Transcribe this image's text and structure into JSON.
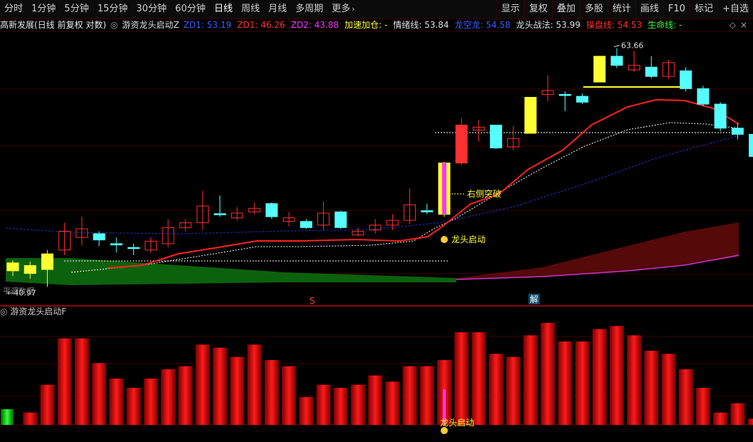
{
  "toolbar": {
    "periods": [
      {
        "label": "分时",
        "active": false
      },
      {
        "label": "1分钟",
        "active": false
      },
      {
        "label": "5分钟",
        "active": false
      },
      {
        "label": "15分钟",
        "active": false
      },
      {
        "label": "30分钟",
        "active": false
      },
      {
        "label": "60分钟",
        "active": false
      },
      {
        "label": "日线",
        "active": true
      },
      {
        "label": "周线",
        "active": false
      },
      {
        "label": "月线",
        "active": false
      },
      {
        "label": "多周期",
        "active": false
      },
      {
        "label": "更多",
        "active": false
      }
    ],
    "right_buttons": [
      "显示",
      "复权",
      "叠加",
      "多股",
      "统计",
      "画线",
      "F10",
      "标记",
      "+自选"
    ]
  },
  "infobar": {
    "stock": "高新发展(日线 前复权 对数)",
    "indicator": "游资龙头启动Z",
    "items": [
      {
        "label": "ZD1:",
        "value": "53.19",
        "color": "#3a5cff"
      },
      {
        "label": "ZD1:",
        "value": "46.26",
        "color": "#ff3030"
      },
      {
        "label": "ZD2:",
        "value": "43.88",
        "color": "#ff33ff"
      },
      {
        "label": "加速加仓:",
        "value": "-",
        "color": "#ffff33"
      },
      {
        "label": "情绪线:",
        "value": "53.84",
        "color": "#e0e0e0"
      },
      {
        "label": "龙空龙:",
        "value": "54.58",
        "color": "#3a5cff"
      },
      {
        "label": "龙头战法:",
        "value": "53.99",
        "color": "#e0e0e0"
      },
      {
        "label": "操盘线:",
        "value": "54.53",
        "color": "#ff3030"
      },
      {
        "label": "生命线:",
        "value": "-",
        "color": "#33ff33"
      }
    ]
  },
  "main_chart": {
    "high_label": "63.66",
    "low_label": "40.97",
    "annotations": {
      "right_breakout": "右侧突破",
      "dragon_start": "龙头启动",
      "watermark": "平调数据"
    },
    "markers": {
      "s_marker": "S",
      "jie_marker": "解"
    },
    "colors": {
      "up": "#ff3030",
      "down": "#55ffff",
      "ma_red": "#ff2020",
      "ma_white": "#ffffff",
      "ma_blue": "#1a2aa0"
    }
  },
  "sub_chart": {
    "title": "游资龙头启动F",
    "annotation": "龙头启动",
    "values": [
      0.04,
      0.13,
      0.28,
      0.28,
      0.2,
      0.15,
      0.12,
      0.15,
      0.18,
      0.19,
      0.26,
      0.25,
      0.22,
      0.26,
      0.21,
      0.19,
      0.09,
      0.13,
      0.12,
      0.13,
      0.16,
      0.14,
      0.19,
      0.19,
      0.21,
      0.3,
      0.3,
      0.23,
      0.22,
      0.29,
      0.33,
      0.27,
      0.27,
      0.31,
      0.32,
      0.29,
      0.24,
      0.23,
      0.18,
      0.12,
      0.04,
      0.07,
      0.02
    ]
  },
  "candles": [
    {
      "o": 42.8,
      "c": 42.2,
      "h": 43.0,
      "l": 41.8,
      "t": "yellow"
    },
    {
      "o": 42.6,
      "c": 42.0,
      "h": 42.9,
      "l": 41.6,
      "t": "yellow"
    },
    {
      "o": 43.5,
      "c": 42.3,
      "h": 43.8,
      "l": 41.0,
      "t": "yellow"
    },
    {
      "o": 43.8,
      "c": 45.3,
      "h": 46.0,
      "l": 43.4,
      "t": "up"
    },
    {
      "o": 44.8,
      "c": 45.5,
      "h": 46.5,
      "l": 44.2,
      "t": "up"
    },
    {
      "o": 45.1,
      "c": 44.6,
      "h": 45.3,
      "l": 44.1,
      "t": "down"
    },
    {
      "o": 44.3,
      "c": 44.2,
      "h": 44.8,
      "l": 43.6,
      "t": "down"
    },
    {
      "o": 44.0,
      "c": 43.95,
      "h": 44.3,
      "l": 43.4,
      "t": "down"
    },
    {
      "o": 43.8,
      "c": 44.5,
      "h": 44.8,
      "l": 43.6,
      "t": "up"
    },
    {
      "o": 44.3,
      "c": 45.6,
      "h": 46.3,
      "l": 44.0,
      "t": "up"
    },
    {
      "o": 45.6,
      "c": 46.0,
      "h": 46.3,
      "l": 45.3,
      "t": "up"
    },
    {
      "o": 46.0,
      "c": 47.4,
      "h": 48.7,
      "l": 45.4,
      "t": "up"
    },
    {
      "o": 46.7,
      "c": 46.75,
      "h": 48.3,
      "l": 46.5,
      "t": "down"
    },
    {
      "o": 46.4,
      "c": 46.8,
      "h": 47.3,
      "l": 46.2,
      "t": "up"
    },
    {
      "o": 46.9,
      "c": 47.2,
      "h": 47.7,
      "l": 46.7,
      "t": "up"
    },
    {
      "o": 47.6,
      "c": 46.5,
      "h": 47.7,
      "l": 46.3,
      "t": "down"
    },
    {
      "o": 46.1,
      "c": 46.4,
      "h": 46.9,
      "l": 45.7,
      "t": "up"
    },
    {
      "o": 46.1,
      "c": 45.6,
      "h": 46.3,
      "l": 45.5,
      "t": "down"
    },
    {
      "o": 45.8,
      "c": 46.8,
      "h": 47.8,
      "l": 45.4,
      "t": "up"
    },
    {
      "o": 46.9,
      "c": 45.6,
      "h": 47.0,
      "l": 45.5,
      "t": "down"
    },
    {
      "o": 45.0,
      "c": 45.3,
      "h": 45.6,
      "l": 44.9,
      "t": "up"
    },
    {
      "o": 45.4,
      "c": 45.8,
      "h": 46.3,
      "l": 45.1,
      "t": "up"
    },
    {
      "o": 45.8,
      "c": 46.2,
      "h": 46.7,
      "l": 45.4,
      "t": "up"
    },
    {
      "o": 46.2,
      "c": 47.5,
      "h": 48.9,
      "l": 45.9,
      "t": "up"
    },
    {
      "o": 47.0,
      "c": 46.9,
      "h": 47.6,
      "l": 46.7,
      "t": "down"
    },
    {
      "o": 46.7,
      "c": 51.2,
      "h": 51.3,
      "l": 46.5,
      "t": "special"
    },
    {
      "o": 51.2,
      "c": 54.8,
      "h": 55.5,
      "l": 51.0,
      "t": "up"
    },
    {
      "o": 54.3,
      "c": 54.6,
      "h": 55.3,
      "l": 53.2,
      "t": "up"
    },
    {
      "o": 54.8,
      "c": 52.6,
      "h": 54.8,
      "l": 52.5,
      "t": "down"
    },
    {
      "o": 52.7,
      "c": 53.5,
      "h": 54.7,
      "l": 52.4,
      "t": "up"
    },
    {
      "o": 54.0,
      "c": 57.6,
      "h": 57.6,
      "l": 54.0,
      "t": "yellow"
    },
    {
      "o": 57.9,
      "c": 58.3,
      "h": 59.9,
      "l": 57.2,
      "t": "up"
    },
    {
      "o": 57.9,
      "c": 57.85,
      "h": 58.2,
      "l": 56.2,
      "t": "down"
    },
    {
      "o": 57.7,
      "c": 57.1,
      "h": 58.0,
      "l": 56.9,
      "t": "down"
    },
    {
      "o": 59.2,
      "c": 62.0,
      "h": 62.0,
      "l": 59.2,
      "t": "yellow"
    },
    {
      "o": 62.0,
      "c": 61.0,
      "h": 62.9,
      "l": 60.7,
      "t": "down"
    },
    {
      "o": 60.5,
      "c": 61.0,
      "h": 62.6,
      "l": 60.3,
      "t": "up"
    },
    {
      "o": 60.8,
      "c": 59.8,
      "h": 62.0,
      "l": 59.6,
      "t": "down"
    },
    {
      "o": 59.8,
      "c": 61.3,
      "h": 61.6,
      "l": 59.5,
      "t": "up"
    },
    {
      "o": 60.4,
      "c": 58.5,
      "h": 60.8,
      "l": 58.2,
      "t": "down"
    },
    {
      "o": 58.5,
      "c": 56.9,
      "h": 58.8,
      "l": 56.7,
      "t": "down"
    },
    {
      "o": 56.9,
      "c": 54.5,
      "h": 57.1,
      "l": 54.2,
      "t": "down"
    },
    {
      "o": 54.5,
      "c": 53.9,
      "h": 55.0,
      "l": 53.4,
      "t": "down"
    },
    {
      "o": 53.9,
      "c": 51.8,
      "h": 54.0,
      "l": 50.4,
      "t": "down"
    }
  ]
}
